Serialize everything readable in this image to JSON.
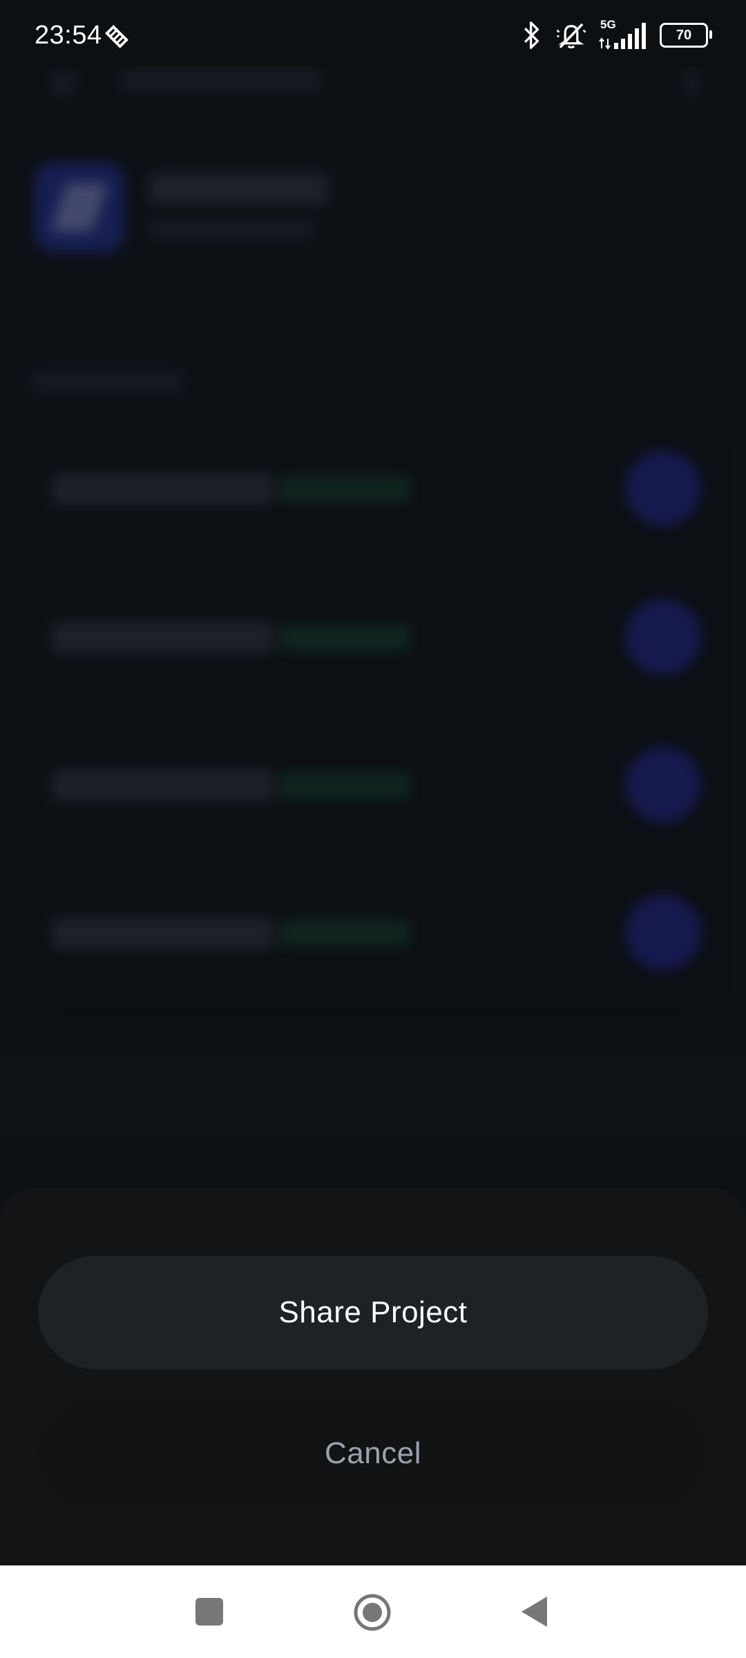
{
  "status_bar": {
    "time": "23:54",
    "network": "5G",
    "battery": "70",
    "icons": [
      "notification-shield-icon",
      "bluetooth-icon",
      "bell-off-icon",
      "signal-icon",
      "battery-icon"
    ]
  },
  "sheet": {
    "share_label": "Share Project",
    "cancel_label": "Cancel"
  },
  "nav_bar": {
    "icons": [
      "recents-icon",
      "home-icon",
      "back-icon"
    ]
  },
  "colors": {
    "sheet_bg": "#121416",
    "button_bg": "#1d2226",
    "accent_blue": "#2a2f9e",
    "time_green": "#1c4738"
  }
}
